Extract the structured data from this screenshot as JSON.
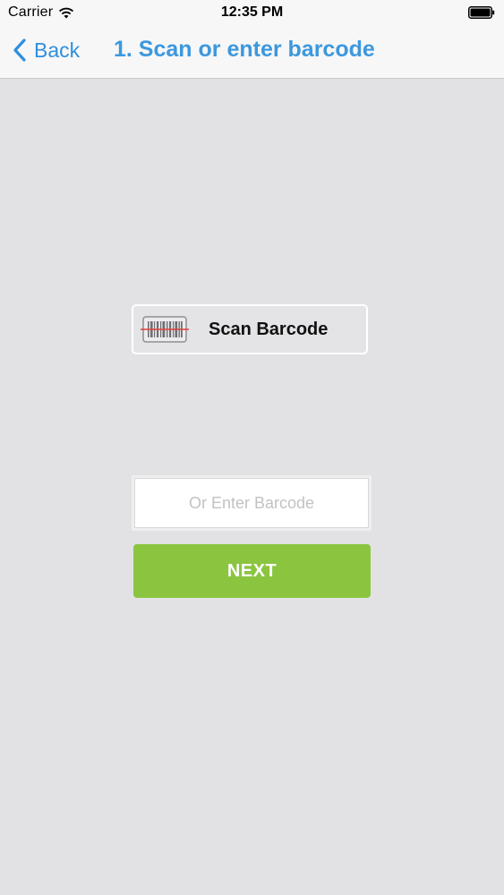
{
  "status_bar": {
    "carrier": "Carrier",
    "time": "12:35 PM",
    "wifi_icon": "wifi-icon",
    "battery_icon": "battery-icon"
  },
  "nav": {
    "back_label": "Back",
    "back_icon": "chevron-left-icon",
    "title": "1. Scan or enter barcode"
  },
  "scan": {
    "label": "Scan Barcode",
    "icon": "barcode-icon"
  },
  "entry": {
    "placeholder": "Or Enter Barcode",
    "value": ""
  },
  "next": {
    "label": "NEXT"
  },
  "colors": {
    "accent": "#3c98dd",
    "next_button": "#8bc540",
    "background": "#e2e2e4",
    "scan_line": "#e0433b"
  }
}
